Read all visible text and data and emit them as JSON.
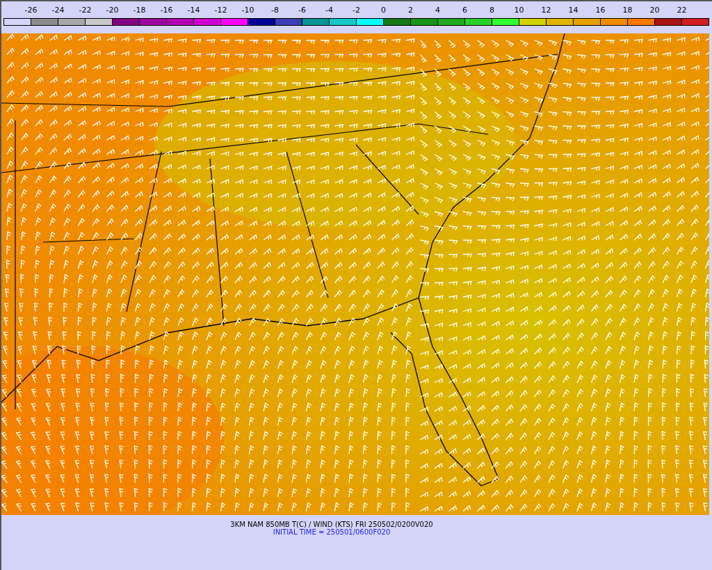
{
  "legend": {
    "labels": [
      "-26",
      "-24",
      "-22",
      "-20",
      "-18",
      "-16",
      "-14",
      "-12",
      "-10",
      "-8",
      "-6",
      "-4",
      "-2",
      "0",
      "2",
      "4",
      "6",
      "8",
      "10",
      "12",
      "14",
      "16",
      "18",
      "20",
      "22"
    ],
    "swatches": [
      {
        "color": "#d4d4f8"
      },
      {
        "color": "#8c8c8c"
      },
      {
        "color": "#a8a8a8"
      },
      {
        "color": "#c8c8c8"
      },
      {
        "color": "#820082"
      },
      {
        "color": "#a000a0"
      },
      {
        "color": "#b400b4"
      },
      {
        "color": "#d200d2"
      },
      {
        "color": "#ff00ff"
      },
      {
        "color": "#000096"
      },
      {
        "color": "#3c3cb4"
      },
      {
        "color": "#009696"
      },
      {
        "color": "#14c8c8"
      },
      {
        "color": "#00ffff"
      },
      {
        "color": "#147814"
      },
      {
        "color": "#169616"
      },
      {
        "color": "#1eaa1e"
      },
      {
        "color": "#28d228"
      },
      {
        "color": "#32ff32"
      },
      {
        "color": "#d2d200"
      },
      {
        "color": "#e1b400"
      },
      {
        "color": "#e6a000"
      },
      {
        "color": "#f08c00"
      },
      {
        "color": "#ff7800"
      },
      {
        "color": "#aa1414"
      },
      {
        "color": "#d21e1e"
      }
    ]
  },
  "caption": {
    "title": "3KM NAM 850MB T(C) / WIND (KTS) FRI 250502/0200V020",
    "initial_time": "INITIAL TIME = 250501/0600F020"
  }
}
